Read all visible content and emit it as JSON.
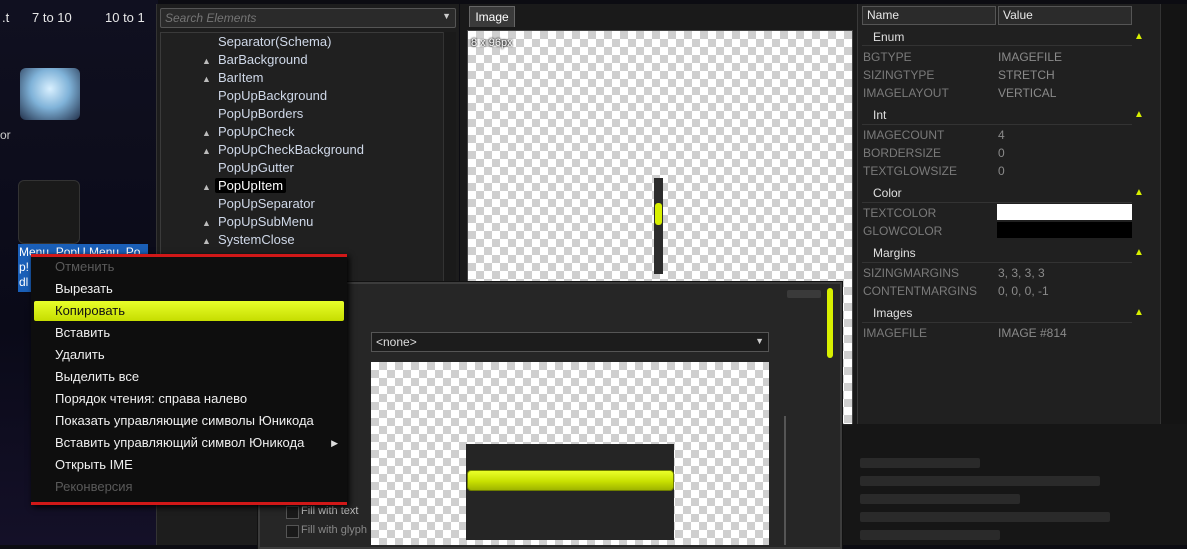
{
  "desktop": {
    "tabs": [
      ".t",
      "7 to 10",
      "10 to 1"
    ],
    "fragments": [
      "or",
      "Menu_PopU Menu_Po",
      "p!",
      "dl",
      "..."
    ]
  },
  "tree": {
    "search_placeholder": "Search Elements",
    "items": [
      {
        "label": "Separator(Schema)",
        "bullet": false
      },
      {
        "label": "BarBackground",
        "bullet": true
      },
      {
        "label": "BarItem",
        "bullet": true
      },
      {
        "label": "PopUpBackground",
        "bullet": false
      },
      {
        "label": "PopUpBorders",
        "bullet": false
      },
      {
        "label": "PopUpCheck",
        "bullet": true
      },
      {
        "label": "PopUpCheckBackground",
        "bullet": true
      },
      {
        "label": "PopUpGutter",
        "bullet": false
      },
      {
        "label": "PopUpItem",
        "bullet": true,
        "selected": true
      },
      {
        "label": "PopUpSeparator",
        "bullet": false
      },
      {
        "label": "PopUpSubMenu",
        "bullet": true
      },
      {
        "label": "SystemClose",
        "bullet": true
      }
    ]
  },
  "image_panel": {
    "tab_label": "Image",
    "size_label": "8 x 96px"
  },
  "properties": {
    "col_name": "Name",
    "col_value": "Value",
    "groups": [
      {
        "title": "Enum",
        "rows": [
          {
            "name": "BGTYPE",
            "value": "IMAGEFILE"
          },
          {
            "name": "SIZINGTYPE",
            "value": "STRETCH"
          },
          {
            "name": "IMAGELAYOUT",
            "value": "VERTICAL"
          }
        ]
      },
      {
        "title": "Int",
        "rows": [
          {
            "name": "IMAGECOUNT",
            "value": "4"
          },
          {
            "name": "BORDERSIZE",
            "value": "0"
          },
          {
            "name": "TEXTGLOWSIZE",
            "value": "0"
          }
        ]
      },
      {
        "title": "Color",
        "rows": [
          {
            "name": "TEXTCOLOR",
            "value": "#ffffff"
          },
          {
            "name": "GLOWCOLOR",
            "value": "#000000"
          }
        ]
      },
      {
        "title": "Margins",
        "rows": [
          {
            "name": "SIZINGMARGINS",
            "value": "3, 3, 3, 3"
          },
          {
            "name": "CONTENTMARGINS",
            "value": "0, 0, 0, -1"
          }
        ]
      },
      {
        "title": "Images",
        "rows": [
          {
            "name": "IMAGEFILE",
            "value": "IMAGE #814"
          }
        ]
      }
    ]
  },
  "dialog": {
    "select_value": "<none>",
    "checkboxes": [
      "Fill with text",
      "Fill with glyph"
    ]
  },
  "context_menu": {
    "items": [
      {
        "label": "Отменить",
        "enabled": false
      },
      {
        "label": "Вырезать",
        "enabled": true
      },
      {
        "label": "Копировать",
        "enabled": true,
        "highlighted": true
      },
      {
        "label": "Вставить",
        "enabled": true
      },
      {
        "label": "Удалить",
        "enabled": true
      },
      {
        "label": "Выделить все",
        "enabled": true
      },
      {
        "label": "Порядок чтения: справа налево",
        "enabled": true
      },
      {
        "label": "Показать управляющие символы Юникода",
        "enabled": true
      },
      {
        "label": "Вставить управляющий символ Юникода",
        "enabled": true,
        "submenu": true
      },
      {
        "label": "Открыть IME",
        "enabled": true
      },
      {
        "label": "Реконверсия",
        "enabled": false
      }
    ]
  },
  "colors": {
    "accent": "#d8f000",
    "menu_border": "#d01818",
    "panel_bg": "#202020"
  }
}
